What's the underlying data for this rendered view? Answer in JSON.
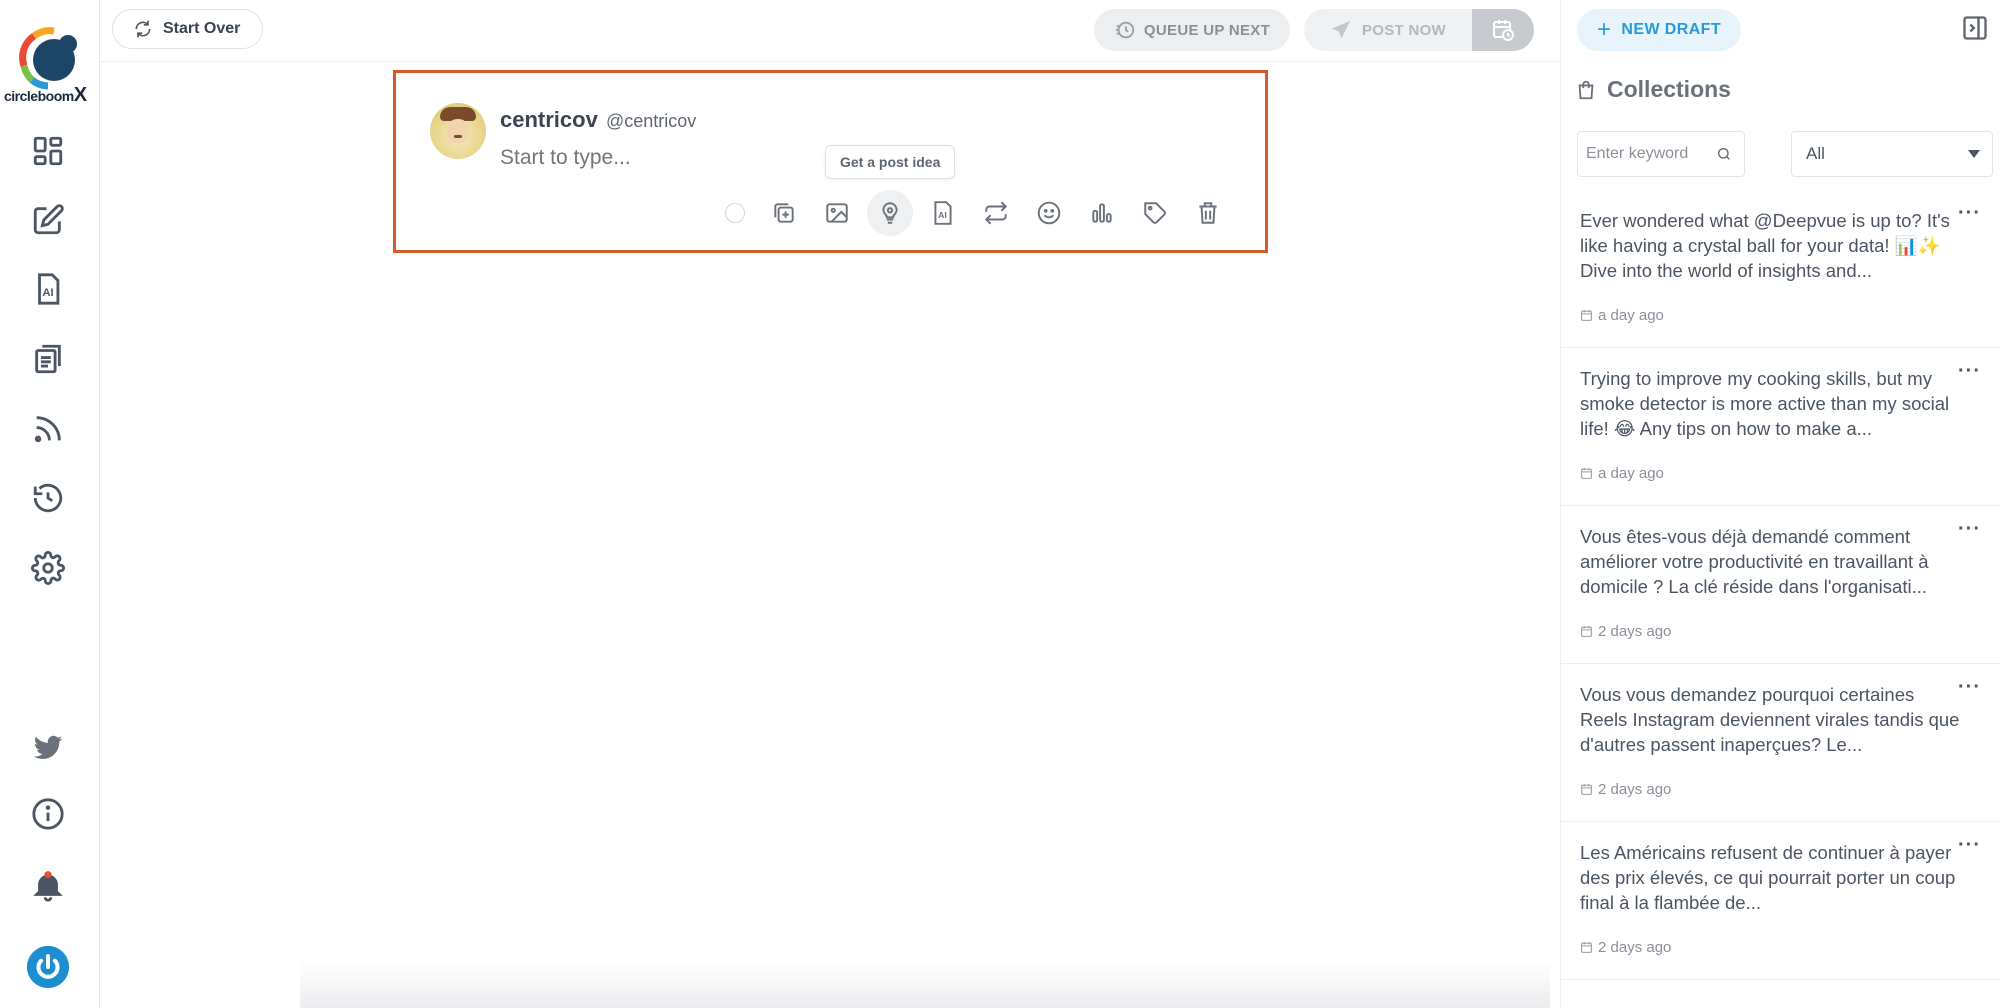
{
  "brand": {
    "name": "circleboom",
    "suffix": "X"
  },
  "topbar": {
    "start_over": "Start Over",
    "queue_up_next": "QUEUE UP NEXT",
    "post_now": "POST NOW"
  },
  "compose": {
    "user_name": "centricov",
    "user_handle": "@centricov",
    "placeholder": "Start to type...",
    "tooltip": "Get a post idea"
  },
  "right_panel": {
    "new_draft": "NEW DRAFT",
    "collections_title": "Collections",
    "search_placeholder": "Enter keyword",
    "filter_selected": "All",
    "items": [
      {
        "text": "Ever wondered what @Deepvue is up to? It's like having a crystal ball for your data! 📊✨ Dive into the world of insights and...",
        "time": "a day ago"
      },
      {
        "text": "Trying to improve my cooking skills, but my smoke detector is more active than my social life! 😂 Any tips on how to make a...",
        "time": "a day ago"
      },
      {
        "text": "Vous êtes-vous déjà demandé comment améliorer votre productivité en travaillant à domicile ? La clé réside dans l'organisati...",
        "time": "2 days ago"
      },
      {
        "text": "Vous vous demandez pourquoi certaines Reels Instagram deviennent virales tandis que d'autres passent inaperçues? Le...",
        "time": "2 days ago"
      },
      {
        "text": "Les Américains refusent de continuer à payer des prix élevés, ce qui pourrait porter un coup final à la flambée de...",
        "time": "2 days ago"
      }
    ]
  },
  "colors": {
    "accent": "#2a9ad6",
    "highlight_border": "#d35b2a",
    "power_button": "#1d8fd1"
  }
}
